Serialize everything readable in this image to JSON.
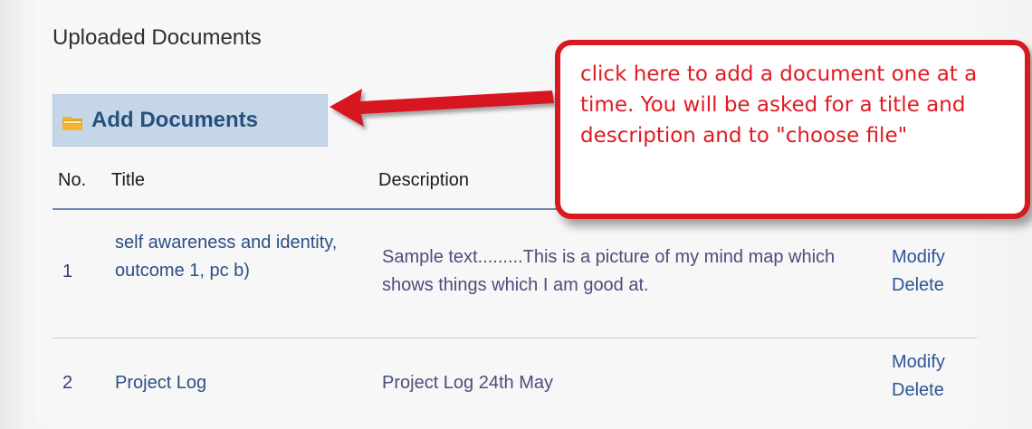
{
  "section": {
    "heading": "Uploaded Documents"
  },
  "actions": {
    "add_documents_label": "Add Documents"
  },
  "table": {
    "headers": {
      "no": "No.",
      "title": "Title",
      "description": "Description"
    },
    "rows": [
      {
        "no": "1",
        "title": "self awareness and identity, outcome 1, pc b)",
        "description": "Sample text.........This is a picture of my mind map which shows things which I am good at.",
        "modify": "Modify",
        "delete": "Delete"
      },
      {
        "no": "2",
        "title": "Project Log",
        "description": "Project Log 24th May",
        "modify": "Modify",
        "delete": "Delete"
      }
    ]
  },
  "annotation": {
    "text": "click here to add a document one at a time.  You will be asked for a title and description and to \"choose file\"",
    "color": "#e01a22",
    "border_color": "#d71920"
  },
  "icons": {
    "add_documents": "folder-icon",
    "pointer": "arrow-left-icon"
  },
  "colors": {
    "accent": "#c5d6e9",
    "link": "#2f5597",
    "header_rule": "#6f87b2"
  }
}
